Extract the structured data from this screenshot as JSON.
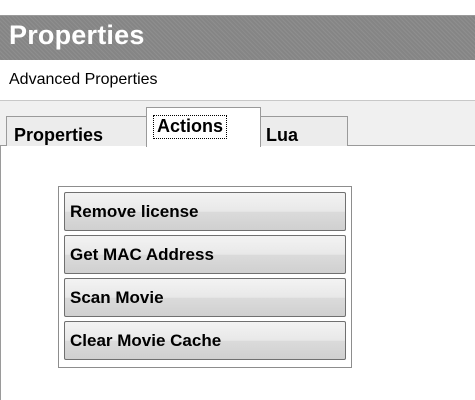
{
  "header": {
    "title": "Properties"
  },
  "subheader": {
    "text": "Advanced Properties"
  },
  "tabs": [
    {
      "label": "Properties"
    },
    {
      "label": "Actions"
    },
    {
      "label": "Lua"
    }
  ],
  "actions": [
    {
      "label": "Remove license"
    },
    {
      "label": "Get MAC Address"
    },
    {
      "label": "Scan Movie"
    },
    {
      "label": "Clear Movie Cache"
    }
  ],
  "colors": {
    "header_bg": "#858585",
    "header_text": "#ffffff",
    "tabstrip_bg": "#f0f0f0",
    "button_bg": "#e8e8e8"
  }
}
